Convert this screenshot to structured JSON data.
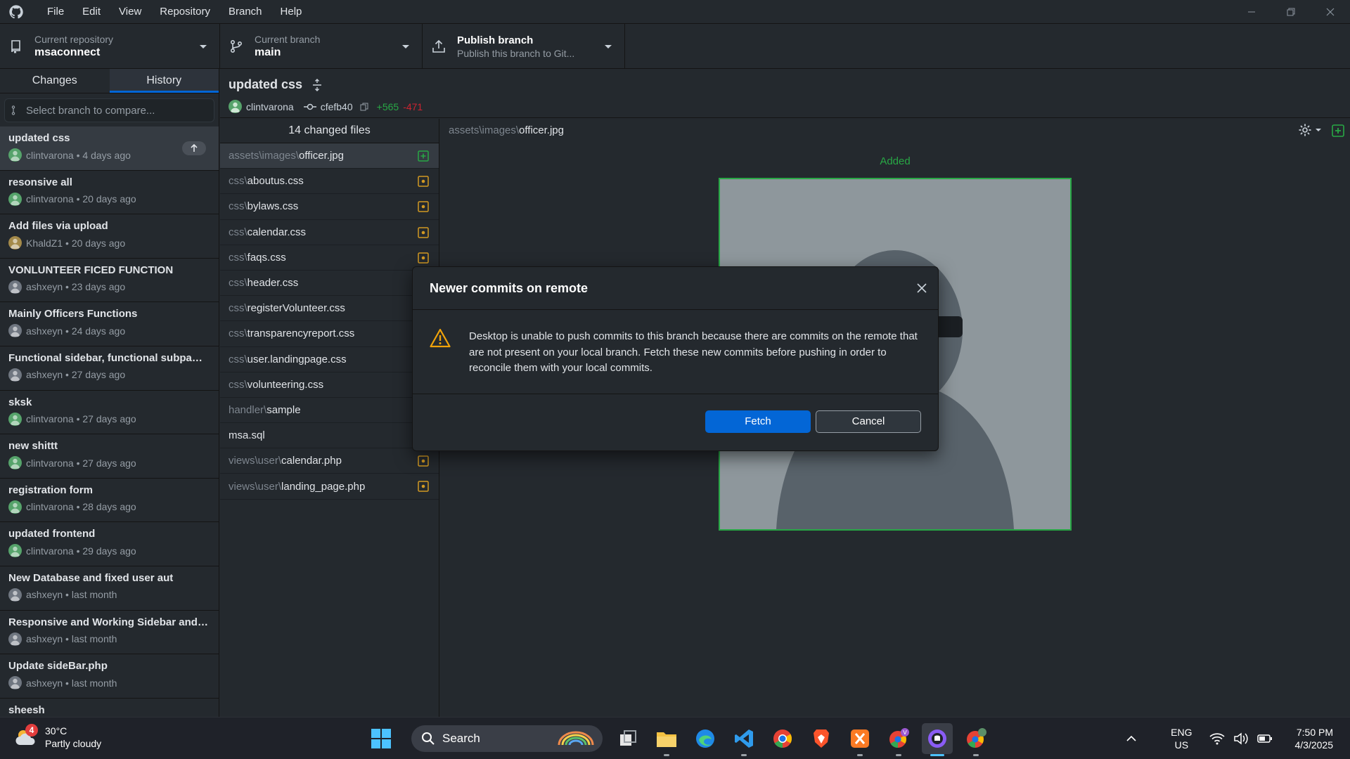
{
  "menu": [
    "File",
    "Edit",
    "View",
    "Repository",
    "Branch",
    "Help"
  ],
  "toolbar": {
    "repo_label": "Current repository",
    "repo_value": "msaconnect",
    "branch_label": "Current branch",
    "branch_value": "main",
    "publish_label": "Publish branch",
    "publish_sub": "Publish this branch to Git..."
  },
  "tabs": {
    "changes": "Changes",
    "history": "History"
  },
  "branch_filter": {
    "placeholder": "Select branch to compare..."
  },
  "commits": [
    {
      "title": "updated css",
      "author": "clintvarona",
      "when": "4 days ago",
      "avatar": "green"
    },
    {
      "title": "resonsive all",
      "author": "clintvarona",
      "when": "20 days ago",
      "avatar": "green"
    },
    {
      "title": "Add files via upload",
      "author": "KhaldZ1",
      "when": "20 days ago",
      "avatar": "gold"
    },
    {
      "title": "VONLUNTEER FICED FUNCTION",
      "author": "ashxeyn",
      "when": "23 days ago",
      "avatar": "gray"
    },
    {
      "title": "Mainly Officers Functions",
      "author": "ashxeyn",
      "when": "24 days ago",
      "avatar": "gray"
    },
    {
      "title": "Functional sidebar, functional subpage...",
      "author": "ashxeyn",
      "when": "27 days ago",
      "avatar": "gray"
    },
    {
      "title": "sksk",
      "author": "clintvarona",
      "when": "27 days ago",
      "avatar": "green"
    },
    {
      "title": "new shittt",
      "author": "clintvarona",
      "when": "27 days ago",
      "avatar": "green"
    },
    {
      "title": "registration form",
      "author": "clintvarona",
      "when": "28 days ago",
      "avatar": "green"
    },
    {
      "title": "updated frontend",
      "author": "clintvarona",
      "when": "29 days ago",
      "avatar": "green"
    },
    {
      "title": "New Database and fixed user aut",
      "author": "ashxeyn",
      "when": "last month",
      "avatar": "gray"
    },
    {
      "title": "Responsive and Working Sidebar and c...",
      "author": "ashxeyn",
      "when": "last month",
      "avatar": "gray"
    },
    {
      "title": "Update sideBar.php",
      "author": "ashxeyn",
      "when": "last month",
      "avatar": "gray"
    },
    {
      "title": "sheesh",
      "author": "",
      "when": "",
      "avatar": "gray"
    }
  ],
  "commit_detail": {
    "title": "updated css",
    "author": "clintvarona",
    "sha": "cfefb40",
    "additions": "+565",
    "deletions": "-471"
  },
  "files": {
    "count_label": "14 changed files",
    "items": [
      {
        "dir": "assets\\images\\",
        "name": "officer.jpg",
        "status": "added"
      },
      {
        "dir": "css\\",
        "name": "aboutus.css",
        "status": "modified"
      },
      {
        "dir": "css\\",
        "name": "bylaws.css",
        "status": "modified"
      },
      {
        "dir": "css\\",
        "name": "calendar.css",
        "status": "modified"
      },
      {
        "dir": "css\\",
        "name": "faqs.css",
        "status": "modified"
      },
      {
        "dir": "css\\",
        "name": "header.css",
        "status": "modified"
      },
      {
        "dir": "css\\",
        "name": "registerVolunteer.css",
        "status": "modified"
      },
      {
        "dir": "css\\",
        "name": "transparencyreport.css",
        "status": "modified"
      },
      {
        "dir": "css\\",
        "name": "user.landingpage.css",
        "status": "modified"
      },
      {
        "dir": "css\\",
        "name": "volunteering.css",
        "status": "modified"
      },
      {
        "dir": "handler\\",
        "name": "sample",
        "status": "modified"
      },
      {
        "dir": "",
        "name": "msa.sql",
        "status": "modified"
      },
      {
        "dir": "views\\user\\",
        "name": "calendar.php",
        "status": "modified"
      },
      {
        "dir": "views\\user\\",
        "name": "landing_page.php",
        "status": "modified"
      }
    ]
  },
  "diff": {
    "path_dir": "assets\\images\\",
    "path_name": "officer.jpg",
    "added_label": "Added"
  },
  "dialog": {
    "title": "Newer commits on remote",
    "message": "Desktop is unable to push commits to this branch because there are commits on the remote that are not present on your local branch. Fetch these new commits before pushing in order to reconcile them with your local commits.",
    "fetch": "Fetch",
    "cancel": "Cancel"
  },
  "taskbar": {
    "weather_badge": "4",
    "temp": "30°C",
    "condition": "Partly cloudy",
    "search": "Search",
    "lang_top": "ENG",
    "lang_bottom": "US",
    "time": "7:50 PM",
    "date": "4/3/2025"
  },
  "colors": {
    "accent": "#0366d6",
    "added": "#28a745",
    "deleted": "#cb2431",
    "modified": "#d29922"
  }
}
